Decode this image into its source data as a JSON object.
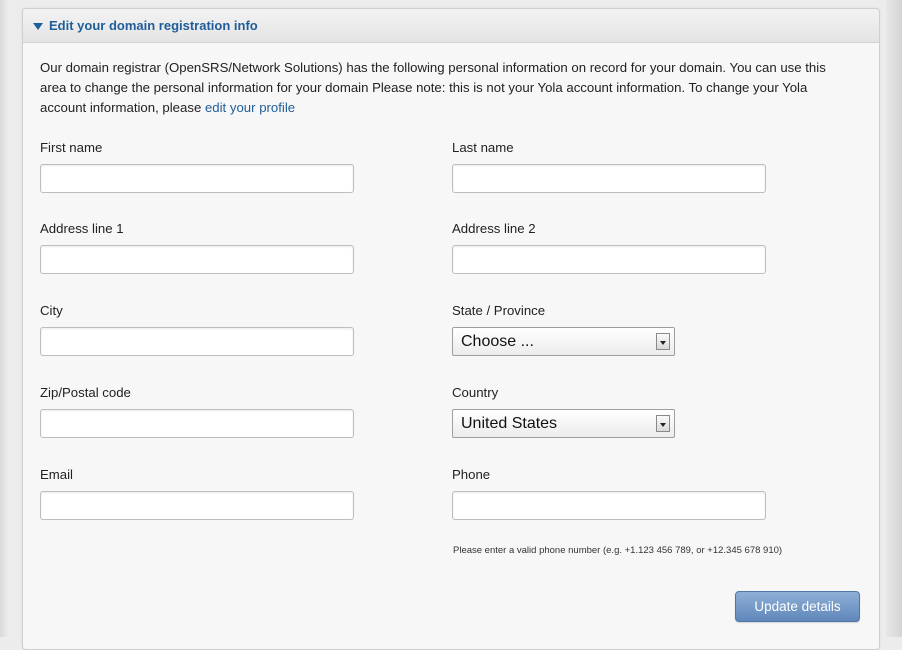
{
  "panel": {
    "title": "Edit your domain registration info",
    "intro_text": "Our domain registrar (OpenSRS/Network Solutions) has the following personal information on record for your domain. You can use this area to change the personal information for your domain Please note: this is not your Yola account information. To change your Yola account information, please ",
    "intro_link": "edit your profile"
  },
  "form": {
    "first_name": {
      "label": "First name",
      "value": ""
    },
    "last_name": {
      "label": "Last name",
      "value": ""
    },
    "address_line_1": {
      "label": "Address line 1",
      "value": ""
    },
    "address_line_2": {
      "label": "Address line 2",
      "value": ""
    },
    "city": {
      "label": "City",
      "value": ""
    },
    "state": {
      "label": "State / Province",
      "selected": "Choose ..."
    },
    "zip": {
      "label": "Zip/Postal code",
      "value": ""
    },
    "country": {
      "label": "Country",
      "selected": "United States"
    },
    "email": {
      "label": "Email",
      "value": ""
    },
    "phone": {
      "label": "Phone",
      "value": "",
      "help": "Please enter a valid phone number (e.g. +1.123 456 789, or +12.345 678 910)"
    },
    "submit_label": "Update details"
  },
  "colors": {
    "link": "#1f5e9a",
    "button": "#6f93c4"
  },
  "icons": {
    "header_toggle": "triangle-down-icon",
    "select_arrow": "chevron-down-icon"
  }
}
